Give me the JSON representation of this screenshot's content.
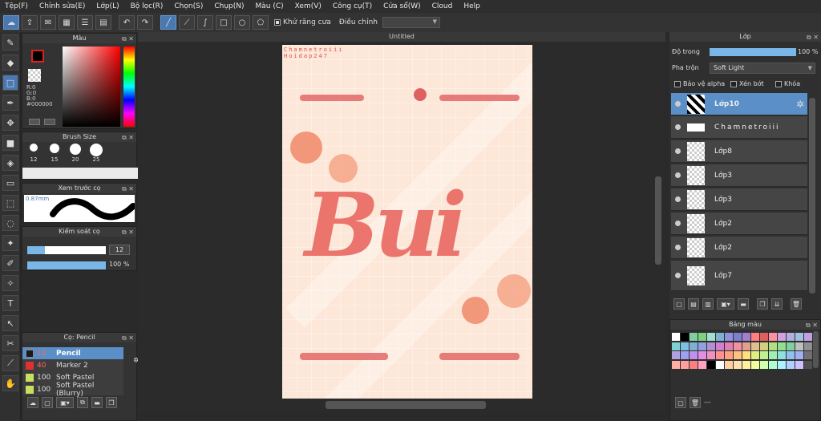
{
  "menu": [
    "Tệp(F)",
    "Chỉnh sửa(E)",
    "Lớp(L)",
    "Bộ lọc(R)",
    "Chọn(S)",
    "Chụp(N)",
    "Màu (C)",
    "Xem(V)",
    "Công cụ(T)",
    "Cửa sổ(W)",
    "Cloud",
    "Help"
  ],
  "toolbar": {
    "antialias_label": "Khử răng cưa",
    "adjust_label": "Điều chỉnh",
    "adjust_value": ""
  },
  "color_panel": {
    "title": "Màu",
    "r": "R:0",
    "g": "G:0",
    "b": "B:0",
    "hex": "#000000",
    "fg_color": "#000000",
    "bg_color": "#ffffff"
  },
  "brush_size_panel": {
    "title": "Brush Size",
    "sizes": [
      "12",
      "15",
      "20",
      "25"
    ]
  },
  "brush_preview_panel": {
    "title": "Xem trước cọ",
    "size_label": "0.87mm"
  },
  "brush_control_panel": {
    "title": "Kiểm soát cọ",
    "size_value": "12",
    "opacity_value": "100 %"
  },
  "brush_list_panel": {
    "title": "Cọ: Pencil",
    "items": [
      {
        "size": "12",
        "name": "Pencil",
        "color": "#1a1a1a"
      },
      {
        "size": "40",
        "name": "Marker 2",
        "color": "#e03030"
      },
      {
        "size": "100",
        "name": "Soft Pastel",
        "color": "#c8e060"
      },
      {
        "size": "100",
        "name": "Soft Pastel (Blurry)",
        "color": "#c8e060"
      }
    ]
  },
  "document": {
    "title": "Untitled",
    "watermark1": "Chamnetroiii",
    "watermark2": "Hoidap247",
    "art_text": "Bui"
  },
  "layer_panel": {
    "title": "Lớp",
    "opacity_label": "Độ trong",
    "opacity_value": "100 %",
    "blend_label": "Pha trộn",
    "blend_value": "Soft Light",
    "protect_alpha_label": "Bảo vệ alpha",
    "clip_label": "Xén bớt",
    "lock_label": "Khóa",
    "layers": [
      "Lớp10",
      "Chamnetroiii",
      "Lớp8",
      "Lớp3",
      "Lớp3",
      "Lớp2",
      "Lớp2",
      "Lớp7"
    ]
  },
  "palette_panel": {
    "title": "Bảng màu",
    "footer_text": "---",
    "colors": [
      "#ffffff",
      "#000000",
      "#7fd0a0",
      "#7fd07f",
      "#a0e0d0",
      "#7fb0d0",
      "#9090e0",
      "#7f7fd0",
      "#a07fd0",
      "#ff7f7f",
      "#e06060",
      "#ff90a0",
      "#d0a0e0",
      "#b0b0e0",
      "#a0c0e0",
      "#c0a0e0",
      "#7fd0d0",
      "#7fc0e0",
      "#7fb0d0",
      "#90a0e0",
      "#b090d0",
      "#d080d0",
      "#e080b0",
      "#f090a0",
      "#e0a090",
      "#e0c090",
      "#d0d080",
      "#b0e080",
      "#90e090",
      "#80d0a0",
      "#c0c0c0",
      "#909090",
      "#b0a0e0",
      "#a0a0f0",
      "#c090f0",
      "#e090e0",
      "#f090c0",
      "#ff9090",
      "#ffa080",
      "#ffc080",
      "#ffe080",
      "#e0f080",
      "#c0f090",
      "#a0f0b0",
      "#90e0e0",
      "#90c0f0",
      "#a0b0f0",
      "#707070",
      "#ffb0a0",
      "#ffa0a0",
      "#ff8080",
      "#ffa0c0",
      "#000000",
      "#ffffff",
      "#ffd0a0",
      "#ffe0b0",
      "#fff0a0",
      "#f0ffa0",
      "#d0ffb0",
      "#b0ffd0",
      "#b0f0ff",
      "#b0d0ff",
      "#d0c0ff",
      "#505050"
    ]
  }
}
